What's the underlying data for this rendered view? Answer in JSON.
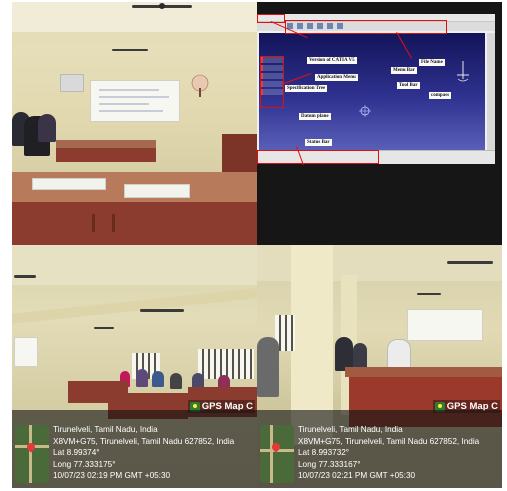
{
  "catia": {
    "labels": {
      "version": "Version of CATIA V5",
      "menu_bar": "Menu Bar",
      "file_name": "File Name",
      "app_menu": "Application Menu",
      "spec_tree": "Specification Tree",
      "tool_bar": "Tool Bar",
      "compass": "compass",
      "datum_plane": "Datum plane",
      "status_bar": "Status Bar"
    }
  },
  "gps_left": {
    "brand": "GPS Map C",
    "location": "Tirunelveli, Tamil Nadu, India",
    "address": "X8VM+G75, Tirunelveli, Tamil Nadu 627852, India",
    "lat": "Lat 8.99374°",
    "long": "Long 77.333175°",
    "datetime": "10/07/23 02:19 PM GMT +05:30"
  },
  "gps_right": {
    "brand": "GPS Map C",
    "location": "Tirunelveli, Tamil Nadu, India",
    "address": "X8VM+G75, Tirunelveli, Tamil Nadu 627852, India",
    "lat": "Lat 8.993732°",
    "long": "Long 77.333167°",
    "datetime": "10/07/23 02:21 PM GMT +05:30"
  }
}
